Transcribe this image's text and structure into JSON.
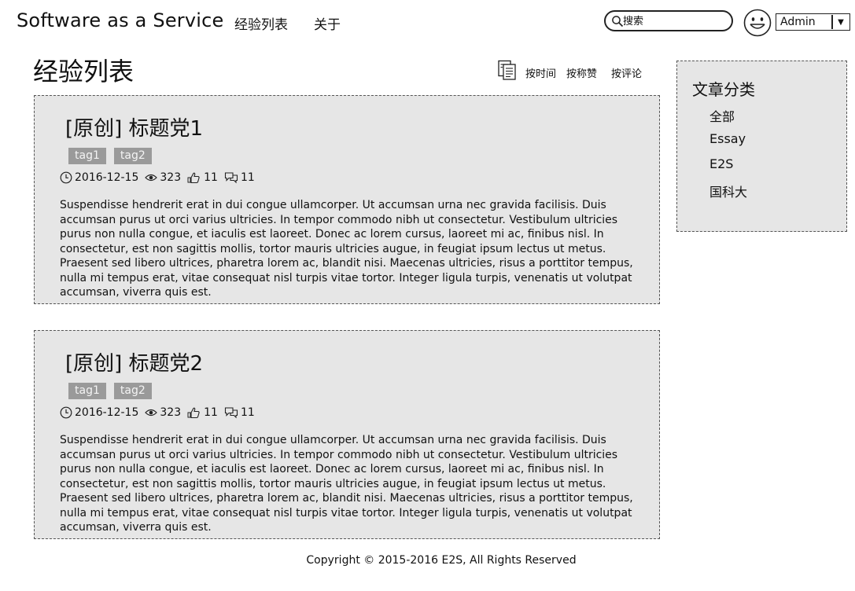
{
  "header": {
    "brand": "Software as a Service",
    "nav": [
      "经验列表",
      "关于"
    ],
    "search_placeholder": "搜索",
    "user": "Admin"
  },
  "page": {
    "title": "经验列表",
    "sort_options": [
      "按时间",
      "按称赞",
      "按评论"
    ]
  },
  "articles": [
    {
      "title": "[原创] 标题党1",
      "tags": [
        "tag1",
        "tag2"
      ],
      "date": "2016-12-15",
      "views": "323",
      "likes": "11",
      "comments": "11",
      "body": "Suspendisse hendrerit erat in dui congue ullamcorper. Ut accumsan urna nec gravida facilisis. Duis accumsan purus ut orci varius ultricies. In tempor commodo nibh ut consectetur. Vestibulum ultricies purus non nulla congue, et iaculis est laoreet. Donec ac lorem cursus, laoreet mi ac, finibus nisl. In consectetur, est non sagittis mollis, tortor mauris ultricies augue, in feugiat ipsum lectus ut metus. Praesent sed libero ultrices, pharetra lorem ac, blandit nisi. Maecenas ultricies, risus a porttitor tempus, nulla mi tempus erat, vitae consequat nisl turpis vitae tortor. Integer ligula turpis, venenatis ut volutpat accumsan, viverra quis est."
    },
    {
      "title": "[原创] 标题党2",
      "tags": [
        "tag1",
        "tag2"
      ],
      "date": "2016-12-15",
      "views": "323",
      "likes": "11",
      "comments": "11",
      "body": "Suspendisse hendrerit erat in dui congue ullamcorper. Ut accumsan urna nec gravida facilisis. Duis accumsan purus ut orci varius ultricies. In tempor commodo nibh ut consectetur. Vestibulum ultricies purus non nulla congue, et iaculis est laoreet. Donec ac lorem cursus, laoreet mi ac, finibus nisl. In consectetur, est non sagittis mollis, tortor mauris ultricies augue, in feugiat ipsum lectus ut metus. Praesent sed libero ultrices, pharetra lorem ac, blandit nisi. Maecenas ultricies, risus a porttitor tempus, nulla mi tempus erat, vitae consequat nisl turpis vitae tortor. Integer ligula turpis, venenatis ut volutpat accumsan, viverra quis est."
    }
  ],
  "sidebar": {
    "title": "文章分类",
    "categories": [
      "全部",
      "Essay",
      "E2S",
      "国科大"
    ]
  },
  "footer": {
    "copyright": "Copyright © 2015-2016 E2S, All Rights Reserved"
  },
  "icons": {
    "search": "search-icon",
    "avatar": "smiley-avatar-icon",
    "dropdown": "chevron-down-icon",
    "sort": "document-list-icon",
    "date": "clock-icon",
    "views": "eye-icon",
    "likes": "thumbs-up-icon",
    "comments": "speech-bubble-icon"
  },
  "colors": {
    "panel_bg": "#e6e6e6",
    "tag_bg": "#9a9a9a",
    "tag_text": "#f4f4f4",
    "border": "#555555"
  }
}
